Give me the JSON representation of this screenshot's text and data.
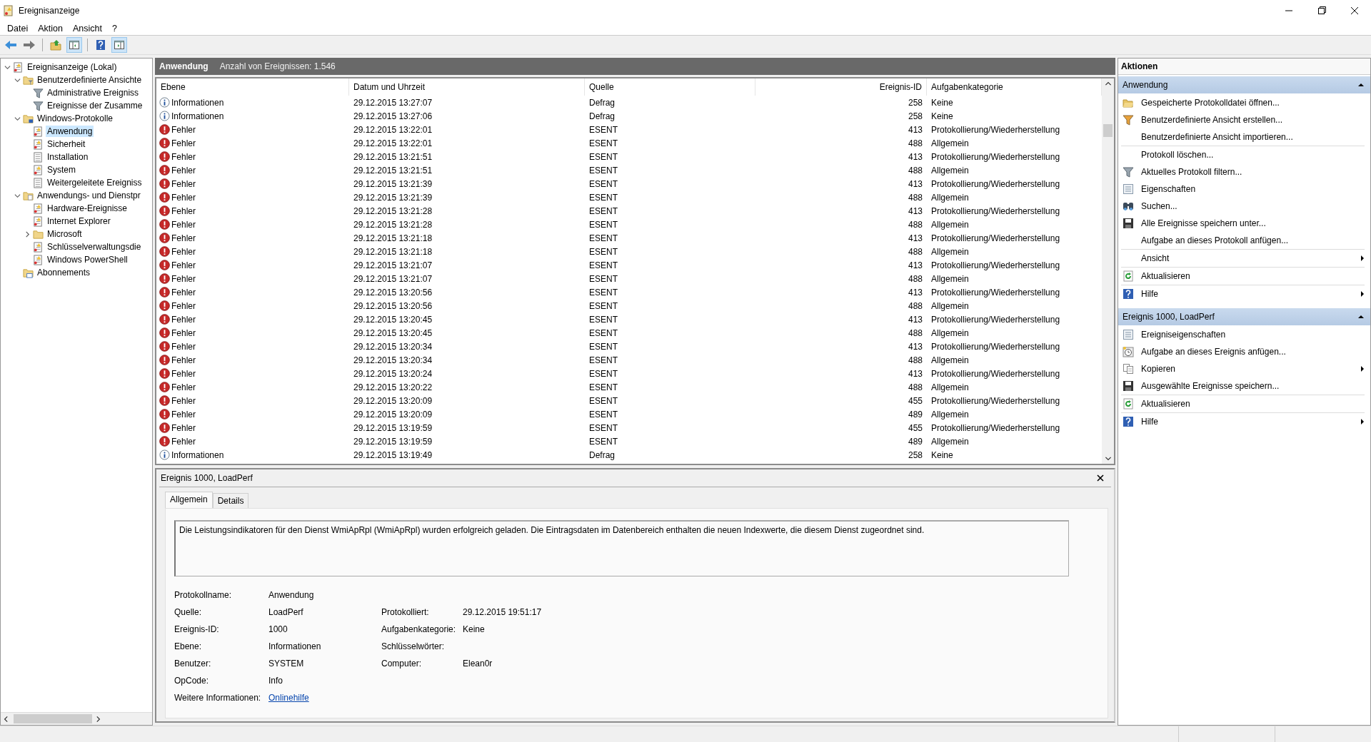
{
  "window": {
    "title": "Ereignisanzeige"
  },
  "menu": [
    "Datei",
    "Aktion",
    "Ansicht",
    "?"
  ],
  "toolbar": [
    {
      "kind": "back"
    },
    {
      "kind": "forward"
    },
    {
      "kind": "sep"
    },
    {
      "kind": "up",
      "pressed": false
    },
    {
      "kind": "tree",
      "pressed": true
    },
    {
      "kind": "sep"
    },
    {
      "kind": "help",
      "pressed": false
    },
    {
      "kind": "actions",
      "pressed": true
    }
  ],
  "tree": [
    {
      "label": "Ereignisanzeige (Lokal)",
      "kind": "root",
      "selected": false,
      "expanded": true,
      "children": [
        {
          "label": "Benutzerdefinierte Ansichte",
          "kind": "folder-filter",
          "selected": false,
          "expanded": true,
          "children": [
            {
              "label": "Administrative Ereigniss",
              "kind": "filter",
              "selected": false
            },
            {
              "label": "Ereignisse der Zusamme",
              "kind": "filter",
              "selected": false
            }
          ]
        },
        {
          "label": "Windows-Protokolle",
          "kind": "folder-win",
          "selected": false,
          "expanded": true,
          "children": [
            {
              "label": "Anwendung",
              "kind": "log",
              "selected": true
            },
            {
              "label": "Sicherheit",
              "kind": "log",
              "selected": false
            },
            {
              "label": "Installation",
              "kind": "plain",
              "selected": false
            },
            {
              "label": "System",
              "kind": "log",
              "selected": false
            },
            {
              "label": "Weitergeleitete Ereigniss",
              "kind": "plain",
              "selected": false
            }
          ]
        },
        {
          "label": "Anwendungs- und Dienstpr",
          "kind": "folder-app",
          "selected": false,
          "expanded": true,
          "children": [
            {
              "label": "Hardware-Ereignisse",
              "kind": "log",
              "selected": false
            },
            {
              "label": "Internet Explorer",
              "kind": "log",
              "selected": false
            },
            {
              "label": "Microsoft",
              "kind": "folder",
              "selected": false,
              "expanded": false
            },
            {
              "label": "Schlüsselverwaltungsdie",
              "kind": "log",
              "selected": false
            },
            {
              "label": "Windows PowerShell",
              "kind": "log",
              "selected": false
            }
          ]
        },
        {
          "label": "Abonnements",
          "kind": "subs",
          "selected": false
        }
      ]
    }
  ],
  "log_header": {
    "name": "Anwendung",
    "count": "Anzahl von Ereignissen: 1.546"
  },
  "table": {
    "columns": [
      "Ebene",
      "Datum und Uhrzeit",
      "Quelle",
      "Ereignis-ID",
      "Aufgabenkategorie"
    ],
    "rows": [
      {
        "kind": "info",
        "level": "Informationen",
        "date": "29.12.2015 13:27:07",
        "source": "Defrag",
        "id": "258",
        "category": "Keine"
      },
      {
        "kind": "info",
        "level": "Informationen",
        "date": "29.12.2015 13:27:06",
        "source": "Defrag",
        "id": "258",
        "category": "Keine"
      },
      {
        "kind": "error",
        "level": "Fehler",
        "date": "29.12.2015 13:22:01",
        "source": "ESENT",
        "id": "413",
        "category": "Protokollierung/Wiederherstellung"
      },
      {
        "kind": "error",
        "level": "Fehler",
        "date": "29.12.2015 13:22:01",
        "source": "ESENT",
        "id": "488",
        "category": "Allgemein"
      },
      {
        "kind": "error",
        "level": "Fehler",
        "date": "29.12.2015 13:21:51",
        "source": "ESENT",
        "id": "413",
        "category": "Protokollierung/Wiederherstellung"
      },
      {
        "kind": "error",
        "level": "Fehler",
        "date": "29.12.2015 13:21:51",
        "source": "ESENT",
        "id": "488",
        "category": "Allgemein"
      },
      {
        "kind": "error",
        "level": "Fehler",
        "date": "29.12.2015 13:21:39",
        "source": "ESENT",
        "id": "413",
        "category": "Protokollierung/Wiederherstellung"
      },
      {
        "kind": "error",
        "level": "Fehler",
        "date": "29.12.2015 13:21:39",
        "source": "ESENT",
        "id": "488",
        "category": "Allgemein"
      },
      {
        "kind": "error",
        "level": "Fehler",
        "date": "29.12.2015 13:21:28",
        "source": "ESENT",
        "id": "413",
        "category": "Protokollierung/Wiederherstellung"
      },
      {
        "kind": "error",
        "level": "Fehler",
        "date": "29.12.2015 13:21:28",
        "source": "ESENT",
        "id": "488",
        "category": "Allgemein"
      },
      {
        "kind": "error",
        "level": "Fehler",
        "date": "29.12.2015 13:21:18",
        "source": "ESENT",
        "id": "413",
        "category": "Protokollierung/Wiederherstellung"
      },
      {
        "kind": "error",
        "level": "Fehler",
        "date": "29.12.2015 13:21:18",
        "source": "ESENT",
        "id": "488",
        "category": "Allgemein"
      },
      {
        "kind": "error",
        "level": "Fehler",
        "date": "29.12.2015 13:21:07",
        "source": "ESENT",
        "id": "413",
        "category": "Protokollierung/Wiederherstellung"
      },
      {
        "kind": "error",
        "level": "Fehler",
        "date": "29.12.2015 13:21:07",
        "source": "ESENT",
        "id": "488",
        "category": "Allgemein"
      },
      {
        "kind": "error",
        "level": "Fehler",
        "date": "29.12.2015 13:20:56",
        "source": "ESENT",
        "id": "413",
        "category": "Protokollierung/Wiederherstellung"
      },
      {
        "kind": "error",
        "level": "Fehler",
        "date": "29.12.2015 13:20:56",
        "source": "ESENT",
        "id": "488",
        "category": "Allgemein"
      },
      {
        "kind": "error",
        "level": "Fehler",
        "date": "29.12.2015 13:20:45",
        "source": "ESENT",
        "id": "413",
        "category": "Protokollierung/Wiederherstellung"
      },
      {
        "kind": "error",
        "level": "Fehler",
        "date": "29.12.2015 13:20:45",
        "source": "ESENT",
        "id": "488",
        "category": "Allgemein"
      },
      {
        "kind": "error",
        "level": "Fehler",
        "date": "29.12.2015 13:20:34",
        "source": "ESENT",
        "id": "413",
        "category": "Protokollierung/Wiederherstellung"
      },
      {
        "kind": "error",
        "level": "Fehler",
        "date": "29.12.2015 13:20:34",
        "source": "ESENT",
        "id": "488",
        "category": "Allgemein"
      },
      {
        "kind": "error",
        "level": "Fehler",
        "date": "29.12.2015 13:20:24",
        "source": "ESENT",
        "id": "413",
        "category": "Protokollierung/Wiederherstellung"
      },
      {
        "kind": "error",
        "level": "Fehler",
        "date": "29.12.2015 13:20:22",
        "source": "ESENT",
        "id": "488",
        "category": "Allgemein"
      },
      {
        "kind": "error",
        "level": "Fehler",
        "date": "29.12.2015 13:20:09",
        "source": "ESENT",
        "id": "455",
        "category": "Protokollierung/Wiederherstellung"
      },
      {
        "kind": "error",
        "level": "Fehler",
        "date": "29.12.2015 13:20:09",
        "source": "ESENT",
        "id": "489",
        "category": "Allgemein"
      },
      {
        "kind": "error",
        "level": "Fehler",
        "date": "29.12.2015 13:19:59",
        "source": "ESENT",
        "id": "455",
        "category": "Protokollierung/Wiederherstellung"
      },
      {
        "kind": "error",
        "level": "Fehler",
        "date": "29.12.2015 13:19:59",
        "source": "ESENT",
        "id": "489",
        "category": "Allgemein"
      },
      {
        "kind": "info",
        "level": "Informationen",
        "date": "29.12.2015 13:19:49",
        "source": "Defrag",
        "id": "258",
        "category": "Keine"
      }
    ]
  },
  "detail": {
    "title": "Ereignis 1000, LoadPerf",
    "tabs": [
      {
        "label": "Allgemein",
        "selected": true
      },
      {
        "label": "Details",
        "selected": false
      }
    ],
    "message": "Die Leistungsindikatoren für den Dienst WmiApRpl (WmiApRpl) wurden erfolgreich geladen. Die Eintragsdaten im Datenbereich enthalten die neuen Indexwerte, die diesem Dienst zugeordnet sind.",
    "fields_left": [
      {
        "label": "Protokollname:",
        "value": "Anwendung"
      },
      {
        "label": "Quelle:",
        "value": "LoadPerf"
      },
      {
        "label": "Ereignis-ID:",
        "value": "1000"
      },
      {
        "label": "Ebene:",
        "value": "Informationen"
      },
      {
        "label": "Benutzer:",
        "value": "SYSTEM"
      },
      {
        "label": "OpCode:",
        "value": "Info"
      }
    ],
    "fields_right": [
      {
        "label": "Protokolliert:",
        "value": "29.12.2015 19:51:17"
      },
      {
        "label": "Aufgabenkategorie:",
        "value": "Keine"
      },
      {
        "label": "Schlüsselwörter:"
      },
      {
        "label": "Computer:",
        "value": "Elean0r"
      }
    ],
    "more_info": {
      "label": "Weitere Informationen:",
      "link": "Onlinehilfe"
    }
  },
  "actions": {
    "title": "Aktionen",
    "sections": [
      {
        "title": "Anwendung",
        "items": [
          {
            "label": "Gespeicherte Protokolldatei öffnen...",
            "kind": "open",
            "submenu": false,
            "separator_before": false
          },
          {
            "label": "Benutzerdefinierte Ansicht erstellen...",
            "kind": "filter-color",
            "submenu": false,
            "separator_before": false
          },
          {
            "label": "Benutzerdefinierte Ansicht importieren...",
            "kind": "none",
            "submenu": false,
            "separator_before": false
          },
          {
            "label": "Protokoll löschen...",
            "kind": "none",
            "submenu": false,
            "separator_before": true
          },
          {
            "label": "Aktuelles Protokoll filtern...",
            "kind": "filter",
            "submenu": false,
            "separator_before": false
          },
          {
            "label": "Eigenschaften",
            "kind": "props",
            "submenu": false,
            "separator_before": false
          },
          {
            "label": "Suchen...",
            "kind": "find",
            "submenu": false,
            "separator_before": false
          },
          {
            "label": "Alle Ereignisse speichern unter...",
            "kind": "save",
            "submenu": false,
            "separator_before": false
          },
          {
            "label": "Aufgabe an dieses Protokoll anfügen...",
            "kind": "none",
            "submenu": false,
            "separator_before": false
          },
          {
            "label": "Ansicht",
            "kind": "none",
            "submenu": true,
            "separator_before": true
          },
          {
            "label": "Aktualisieren",
            "kind": "refresh",
            "submenu": false,
            "separator_before": true
          },
          {
            "label": "Hilfe",
            "kind": "help",
            "submenu": true,
            "separator_before": true
          }
        ]
      },
      {
        "title": "Ereignis 1000, LoadPerf",
        "items": [
          {
            "label": "Ereigniseigenschaften",
            "kind": "props",
            "submenu": false,
            "separator_before": false
          },
          {
            "label": "Aufgabe an dieses Ereignis anfügen...",
            "kind": "task",
            "submenu": false,
            "separator_before": false
          },
          {
            "label": "Kopieren",
            "kind": "copy",
            "submenu": true,
            "separator_before": false
          },
          {
            "label": "Ausgewählte Ereignisse speichern...",
            "kind": "save",
            "submenu": false,
            "separator_before": false
          },
          {
            "label": "Aktualisieren",
            "kind": "refresh",
            "submenu": false,
            "separator_before": true
          },
          {
            "label": "Hilfe",
            "kind": "help",
            "submenu": true,
            "separator_before": true
          }
        ]
      }
    ]
  }
}
